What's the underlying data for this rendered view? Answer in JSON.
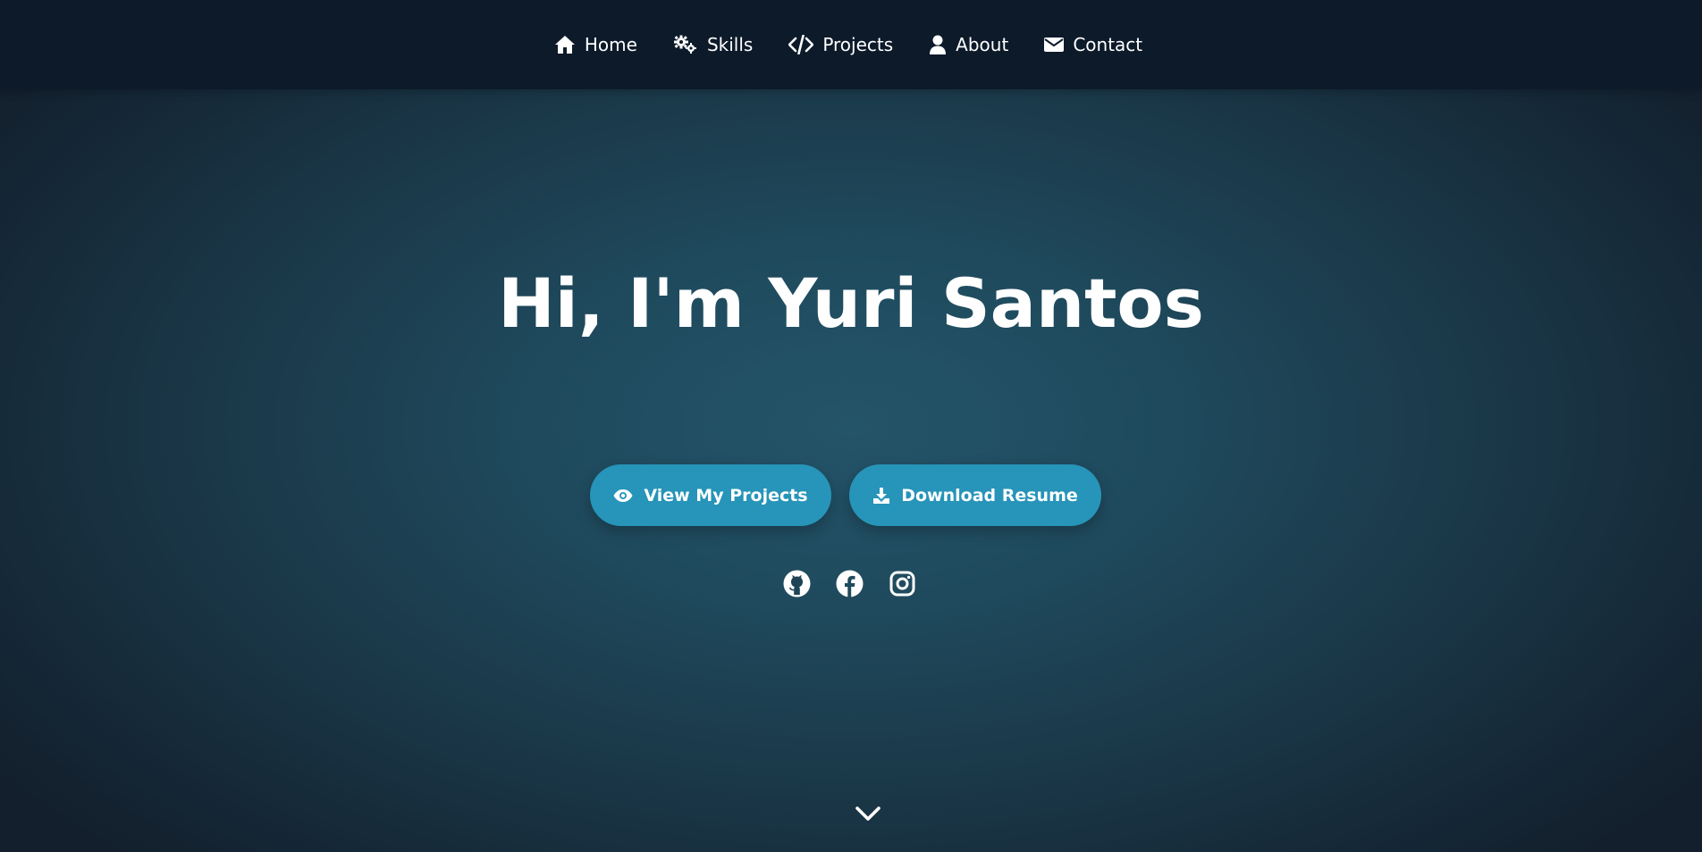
{
  "nav": {
    "items": [
      {
        "label": "Home",
        "icon": "home-icon"
      },
      {
        "label": "Skills",
        "icon": "gears-icon"
      },
      {
        "label": "Projects",
        "icon": "code-icon"
      },
      {
        "label": "About",
        "icon": "user-icon"
      },
      {
        "label": "Contact",
        "icon": "envelope-icon"
      }
    ]
  },
  "hero": {
    "title": "Hi, I'm Yuri Santos",
    "buttons": {
      "projects": {
        "label": "View My Projects",
        "icon": "eye-icon"
      },
      "resume": {
        "label": "Download Resume",
        "icon": "download-icon"
      }
    },
    "socials": [
      {
        "name": "github",
        "icon": "github-icon"
      },
      {
        "name": "facebook",
        "icon": "facebook-icon"
      },
      {
        "name": "instagram",
        "icon": "instagram-icon"
      }
    ],
    "scroll_icon": "chevron-down-icon"
  },
  "colors": {
    "nav_background": "#0c1a2a",
    "accent": "#2794b9",
    "text": "#ffffff",
    "background_center": "#245469",
    "background_edge": "#131f2c"
  }
}
